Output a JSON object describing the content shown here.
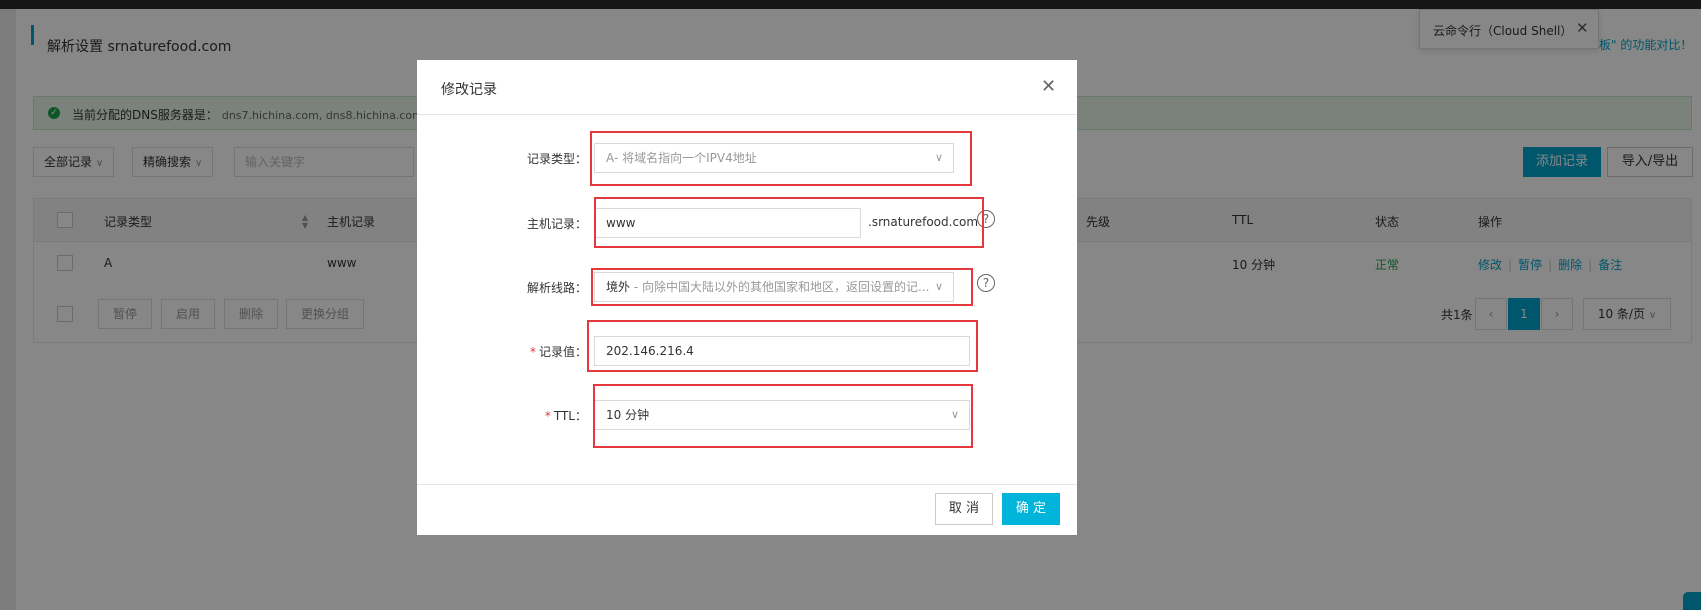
{
  "page": {
    "title": "解析设置 srnaturefood.com",
    "dns_notice": {
      "label": "当前分配的DNS服务器是：",
      "servers": "dns7.hichina.com, dns8.hichina.com"
    },
    "filters": {
      "all_records": "全部记录",
      "exact_search": "精确搜索",
      "keyword_placeholder": "输入关键字"
    },
    "toolbar": {
      "add_record": "添加记录",
      "import_export": "导入/导出"
    },
    "table": {
      "headers": {
        "record_type": "记录类型",
        "host": "主机记录",
        "priority": "先级",
        "ttl": "TTL",
        "status": "状态",
        "actions": "操作"
      },
      "rows": [
        {
          "record_type": "A",
          "host": "www",
          "ttl": "10 分钟",
          "status": "正常",
          "actions": [
            "修改",
            "暂停",
            "删除",
            "备注"
          ]
        }
      ],
      "footer_buttons": [
        "暂停",
        "启用",
        "删除",
        "更换分组"
      ],
      "pagination": {
        "total": "共1条",
        "prev": "‹",
        "current": "1",
        "next": "›",
        "page_size": "10 条/页"
      }
    },
    "cloudshell": {
      "label": "云命令行（Cloud Shell）",
      "close": "✕"
    },
    "compare_text": "板\" 的功能对比！"
  },
  "modal": {
    "title": "修改记录",
    "close": "✕",
    "fields": {
      "record_type": {
        "label": "记录类型：",
        "value": "A- 将域名指向一个IPV4地址"
      },
      "host": {
        "label": "主机记录：",
        "value": "www",
        "suffix": ".srnaturefood.com"
      },
      "line": {
        "label": "解析线路：",
        "value_main": "境外",
        "value_desc": " - 向除中国大陆以外的其他国家和地区，返回设置的记..."
      },
      "record_value": {
        "label": "记录值：",
        "value": "202.146.216.4",
        "required_mark": "*"
      },
      "ttl": {
        "label": "TTL：",
        "value": "10 分钟",
        "required_mark": "*"
      }
    },
    "buttons": {
      "cancel": "取 消",
      "ok": "确 定"
    }
  },
  "icons": {
    "chevron": "chevron-down-icon",
    "help": "question-circle-icon",
    "check": "check-circle-icon",
    "close": "close-icon"
  },
  "colors": {
    "accent": "#00a2ca",
    "confirm": "#00b5d9",
    "highlight": "#e4393c",
    "success": "#1da34a"
  }
}
